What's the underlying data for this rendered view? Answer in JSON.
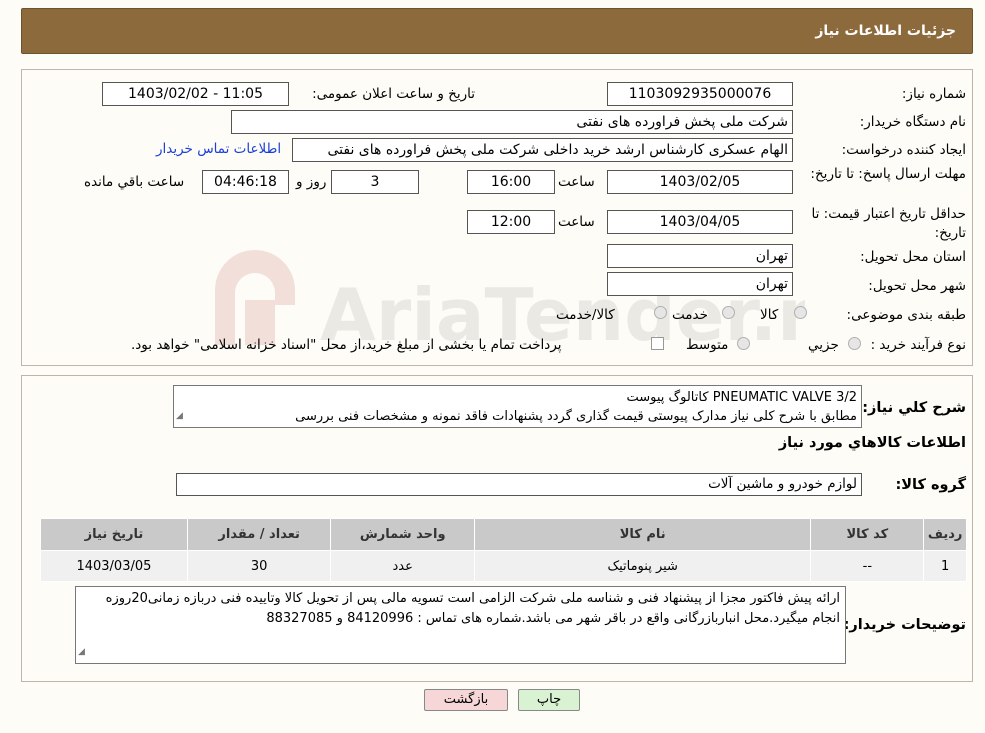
{
  "header": {
    "title": "جزئیات اطلاعات نیاز"
  },
  "form": {
    "need_number_label": "شماره نیاز:",
    "need_number": "1103092935000076",
    "announce_label": "تاریخ و ساعت اعلان عمومی:",
    "announce_value": "1403/02/02 - 11:05",
    "buyer_org_label": "نام دستگاه خریدار:",
    "buyer_org": "شرکت ملی پخش فراورده های نفتی",
    "creator_label": "ایجاد کننده درخواست:",
    "creator": "الهام عسکری کارشناس ارشد خرید داخلی شرکت ملی پخش فراورده های نفتی",
    "contact_link": "اطلاعات تماس خریدار",
    "reply_deadline_label": "مهلت ارسال پاسخ: تا تاریخ:",
    "reply_date": "1403/02/05",
    "time_label": "ساعت",
    "reply_time": "16:00",
    "days": "3",
    "day_and_label": "روز و",
    "remaining_time": "04:46:18",
    "remaining_label": "ساعت باقي مانده",
    "price_validity_label": "حداقل تاریخ اعتبار قیمت: تا تاریخ:",
    "price_validity_date": "1403/04/05",
    "price_validity_time": "12:00",
    "province_label": "استان محل تحویل:",
    "province": "تهران",
    "city_label": "شهر محل تحویل:",
    "city": "تهران",
    "category_label": "طبقه بندی موضوعی:",
    "category_options": [
      "کالا",
      "خدمت",
      "کالا/خدمت"
    ],
    "process_label": "نوع فرآیند خرید :",
    "process_options": [
      "جزيي",
      "متوسط"
    ],
    "process_note": "پرداخت تمام یا بخشی از مبلغ خرید،از محل \"اسناد خزانه اسلامی\" خواهد بود."
  },
  "details": {
    "summary_label": "شرح کلي نياز:",
    "summary_line1": "PNEUMATIC VALVE 3/2 کاتالوگ پیوست",
    "summary_line2": "مطابق با شرح کلی نیاز مدارک پیوستی قیمت گذاری گردد پشنهادات فاقد نمونه و مشخصات فنی بررسی",
    "items_heading": "اطلاعات کالاهاي مورد نياز",
    "group_label": "گروه کالا:",
    "group_value": "لوازم خودرو و ماشین آلات",
    "table": {
      "headers": [
        "رديف",
        "کد کالا",
        "نام کالا",
        "واحد شمارش",
        "تعداد / مقدار",
        "تاريخ نياز"
      ],
      "rows": [
        [
          "1",
          "--",
          "شیر پنوماتیک",
          "عدد",
          "30",
          "1403/03/05"
        ]
      ]
    },
    "buyer_notes_label": "توضیحات خریدار:",
    "buyer_notes": "ارائه پیش فاکتور مجزا از پیشنهاد فنی و شناسه ملی شرکت الزامی است تسویه مالی پس از تحویل کالا وتاییده فنی دربازه زمانی20روزه انجام میگیرد.محل انبارباز‌رگانی واقع در باقر شهر می باشد.شماره های تماس : 84120996 و 88327085"
  },
  "buttons": {
    "print": "چاپ",
    "back": "بازگشت"
  },
  "watermark": {
    "text": "AriaTender.neT"
  },
  "colors": {
    "header_bg": "#8d6a3c",
    "link": "#1a3fd8",
    "back_button_bg": "#f6d6d6",
    "print_button_bg": "#d9f2d2"
  }
}
